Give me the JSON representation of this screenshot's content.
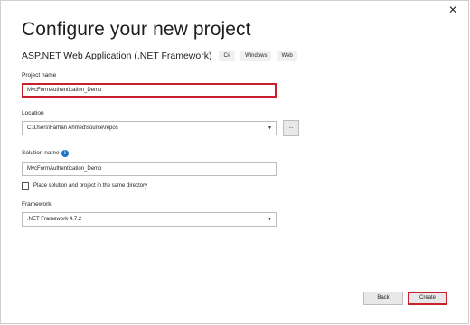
{
  "window": {
    "title": "Configure your new project",
    "close_glyph": "✕"
  },
  "template": {
    "name": "ASP.NET Web Application (.NET Framework)",
    "tags": [
      "C#",
      "Windows",
      "Web"
    ]
  },
  "project_name": {
    "label": "Project name",
    "value": "MvcFormAuthentication_Demo"
  },
  "location": {
    "label": "Location",
    "value": "C:\\Users\\Farhan Ahmed\\source\\repos",
    "browse_label": "..."
  },
  "solution_name": {
    "label": "Solution name",
    "value": "MvcFormAuthentication_Demo",
    "info_glyph": "i"
  },
  "same_directory": {
    "label": "Place solution and project in the same directory",
    "checked": false
  },
  "framework": {
    "label": "Framework",
    "value": ".NET Framework 4.7.2"
  },
  "buttons": {
    "back": "Back",
    "create": "Create"
  },
  "colors": {
    "focus_border": "#c8202c",
    "info_icon": "#1e73c8"
  },
  "icons": {
    "close": "close-icon",
    "info": "info-icon",
    "dropdown": "chevron-down-icon"
  }
}
